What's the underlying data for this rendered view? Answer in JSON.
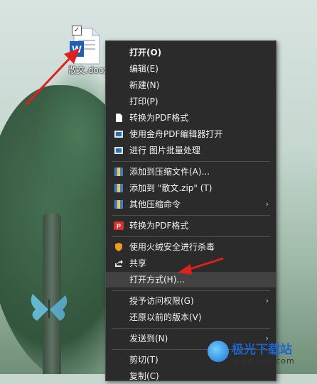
{
  "desktop": {
    "file": {
      "name": "散文.docx",
      "checked_mark": "✓",
      "icon": "word-document-icon"
    }
  },
  "context_menu": {
    "items": [
      {
        "label": "打开(O)",
        "bold": true
      },
      {
        "label": "编辑(E)"
      },
      {
        "label": "新建(N)"
      },
      {
        "label": "打印(P)"
      },
      {
        "label": "转换为PDF格式",
        "icon": "document-icon"
      },
      {
        "label": "使用金舟PDF编辑器打开",
        "icon": "pdf-editor-icon"
      },
      {
        "label": "进行 图片批量处理",
        "icon": "image-batch-icon"
      },
      {
        "label": "添加到压缩文件(A)...",
        "icon": "archive-icon"
      },
      {
        "label": "添加到 \"散文.zip\" (T)",
        "icon": "archive-icon"
      },
      {
        "label": "其他压缩命令",
        "icon": "archive-icon",
        "submenu_arrow": "›"
      },
      {
        "label": "转换为PDF格式",
        "icon": "pdf-convert-icon"
      },
      {
        "label": "使用火绒安全进行杀毒",
        "icon": "shield-icon"
      },
      {
        "label": "共享",
        "icon": "share-icon"
      },
      {
        "label": "打开方式(H)...",
        "highlighted": true
      },
      {
        "label": "授予访问权限(G)",
        "submenu_arrow": "›"
      },
      {
        "label": "还原以前的版本(V)"
      },
      {
        "label": "发送到(N)",
        "submenu_arrow": "›"
      },
      {
        "label": "剪切(T)"
      },
      {
        "label": "复制(C)"
      }
    ]
  },
  "watermark": {
    "title": "极光下载站",
    "url": "www.xz7.com"
  },
  "colors": {
    "menu_bg": "#2b2b2b",
    "highlight": "#424242",
    "arrow": "#e0201c"
  }
}
